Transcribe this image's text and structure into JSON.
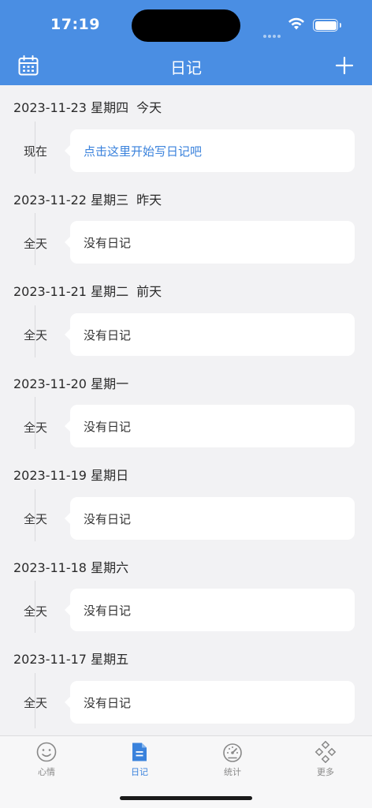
{
  "status_bar": {
    "time": "17:19"
  },
  "nav": {
    "title": "日记",
    "left_icon": "calendar-icon",
    "right_icon": "plus-icon"
  },
  "days": [
    {
      "date": "2023-11-23",
      "weekday": "星期四",
      "relative": "今天",
      "slot": "现在",
      "entry": "点击这里开始写日记吧"
    },
    {
      "date": "2023-11-22",
      "weekday": "星期三",
      "relative": "昨天",
      "slot": "全天",
      "entry": "没有日记"
    },
    {
      "date": "2023-11-21",
      "weekday": "星期二",
      "relative": "前天",
      "slot": "全天",
      "entry": "没有日记"
    },
    {
      "date": "2023-11-20",
      "weekday": "星期一",
      "relative": "",
      "slot": "全天",
      "entry": "没有日记"
    },
    {
      "date": "2023-11-19",
      "weekday": "星期日",
      "relative": "",
      "slot": "全天",
      "entry": "没有日记"
    },
    {
      "date": "2023-11-18",
      "weekday": "星期六",
      "relative": "",
      "slot": "全天",
      "entry": "没有日记"
    },
    {
      "date": "2023-11-17",
      "weekday": "星期五",
      "relative": "",
      "slot": "全天",
      "entry": "没有日记"
    }
  ],
  "tabs": [
    {
      "label": "心情",
      "icon": "smiley-icon"
    },
    {
      "label": "日记",
      "icon": "document-icon"
    },
    {
      "label": "统计",
      "icon": "gauge-icon"
    },
    {
      "label": "更多",
      "icon": "grid-icon"
    }
  ],
  "colors": {
    "accent": "#4a8ee3",
    "link": "#3a82dc",
    "background": "#f2f2f4"
  }
}
